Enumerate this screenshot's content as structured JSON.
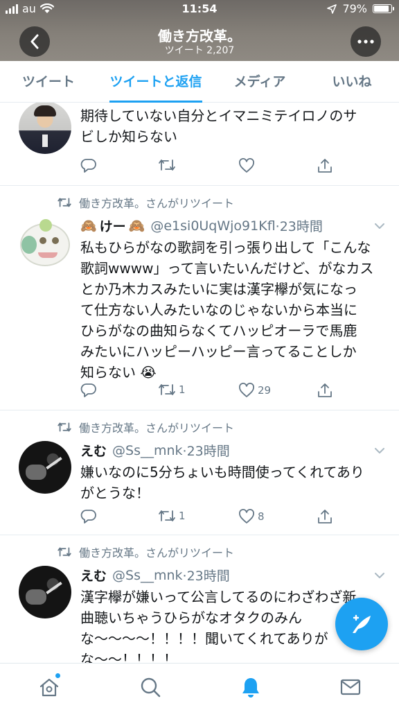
{
  "status": {
    "carrier": "au",
    "time": "11:54",
    "battery_pct": "79%",
    "battery_level": 0.79
  },
  "header": {
    "title": "働き方改革。",
    "subtitle": "ツイート 2,207"
  },
  "tabs": [
    {
      "label": "ツイート"
    },
    {
      "label": "ツイートと返信"
    },
    {
      "label": "メディア"
    },
    {
      "label": "いいね"
    }
  ],
  "tweets": [
    {
      "text": "期待していない自分とイマニミテイロノのサビしか知らない",
      "line1": "期待していない自分とイマニミテイロノのサ",
      "line2": "ビしか知らない",
      "replies": "",
      "retweets": "",
      "likes": ""
    },
    {
      "retweet_label": "働き方改革。さんがリツイート",
      "emoji_left": "🙈",
      "name": "けー",
      "emoji_right": "🙈",
      "handle": "@e1si0UqWjo91Kfl",
      "time": "·23時間",
      "lines": [
        "私もひらがなの歌詞を引っ張り出して「こんな",
        "歌詞wwww」って言いたいんだけど、がなカス",
        "とか乃木カスみたいに実は漢字欅が気になっ",
        "て仕方ない人みたいなのじゃないから本当に",
        "ひらがなの曲知らなくてハッピオーラで馬鹿",
        "みたいにハッピーハッピー言ってることしか",
        "知らない 😭"
      ],
      "retweets": "1",
      "likes": "29"
    },
    {
      "retweet_label": "働き方改革。さんがリツイート",
      "name": "えむ",
      "handle": "@Ss__mnk",
      "time": "·23時間",
      "lines": [
        "嫌いなのに5分ちょいも時間使ってくれてあり",
        "がとうな！"
      ],
      "retweets": "1",
      "likes": "8"
    },
    {
      "retweet_label": "働き方改革。さんがリツイート",
      "name": "えむ",
      "handle": "@Ss__mnk",
      "time": "·23時間",
      "lines": [
        "漢字欅が嫌いって公言してるのにわざわざ新",
        "曲聴いちゃうひらがなオタクのみん",
        "な〜〜〜〜！！！！聞いてくれてありが",
        "な〜〜！！！！"
      ]
    }
  ],
  "icons": {
    "back": "chevron-left-icon",
    "more": "more-icon",
    "reply": "reply-icon",
    "retweet": "retweet-icon",
    "like": "heart-icon",
    "share": "share-icon",
    "compose": "compose-icon",
    "home": "home-icon",
    "search": "search-icon",
    "notifications": "bell-icon",
    "messages": "envelope-icon"
  },
  "colors": {
    "accent": "#1da1f2",
    "secondary_text": "#657786",
    "text": "#14171a"
  }
}
